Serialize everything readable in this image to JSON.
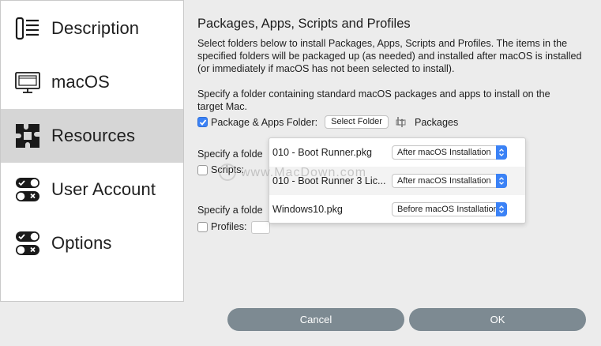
{
  "sidebar": {
    "items": [
      {
        "label": "Description",
        "icon": "description-icon",
        "selected": false
      },
      {
        "label": "macOS",
        "icon": "monitor-icon",
        "selected": false
      },
      {
        "label": "Resources",
        "icon": "puzzle-icon",
        "selected": true
      },
      {
        "label": "User Account",
        "icon": "toggle-icon",
        "selected": false
      },
      {
        "label": "Options",
        "icon": "toggle-icon",
        "selected": false
      }
    ]
  },
  "main": {
    "title": "Packages, Apps, Scripts and Profiles",
    "intro": [
      "Select folders below to install Packages, Apps, Scripts and Profiles. The items in the",
      "specified folders will be packaged up (as needed) and installed after macOS is installed",
      "(or immediately if macOS has not been selected to install)."
    ],
    "packages_section": {
      "text": [
        "Specify a folder containing standard macOS packages and apps to install on the",
        "target Mac."
      ],
      "checkbox_label": "Package & Apps Folder:",
      "checked": true,
      "select_button": "Select Folder",
      "folder_name": "Packages"
    },
    "scripts_section": {
      "text": "Specify a folde",
      "checkbox_label": "Scripts:",
      "checked": false
    },
    "profiles_section": {
      "text": "Specify a folde",
      "checkbox_label": "Profiles:",
      "checked": false
    }
  },
  "popup": {
    "rows": [
      {
        "name": "010 - Boot Runner.pkg",
        "timing": "After macOS Installation"
      },
      {
        "name": "010 - Boot Runner 3 Lic...",
        "timing": "After macOS Installation"
      },
      {
        "name": "Windows10.pkg",
        "timing": "Before macOS Installation"
      }
    ]
  },
  "watermark": "www.MacDown.com",
  "buttons": {
    "cancel": "Cancel",
    "ok": "OK"
  },
  "colors": {
    "accent": "#3b82f6",
    "button_bg": "#7d8a92",
    "selected_bg": "#d6d6d6",
    "window_bg": "#ececec"
  }
}
